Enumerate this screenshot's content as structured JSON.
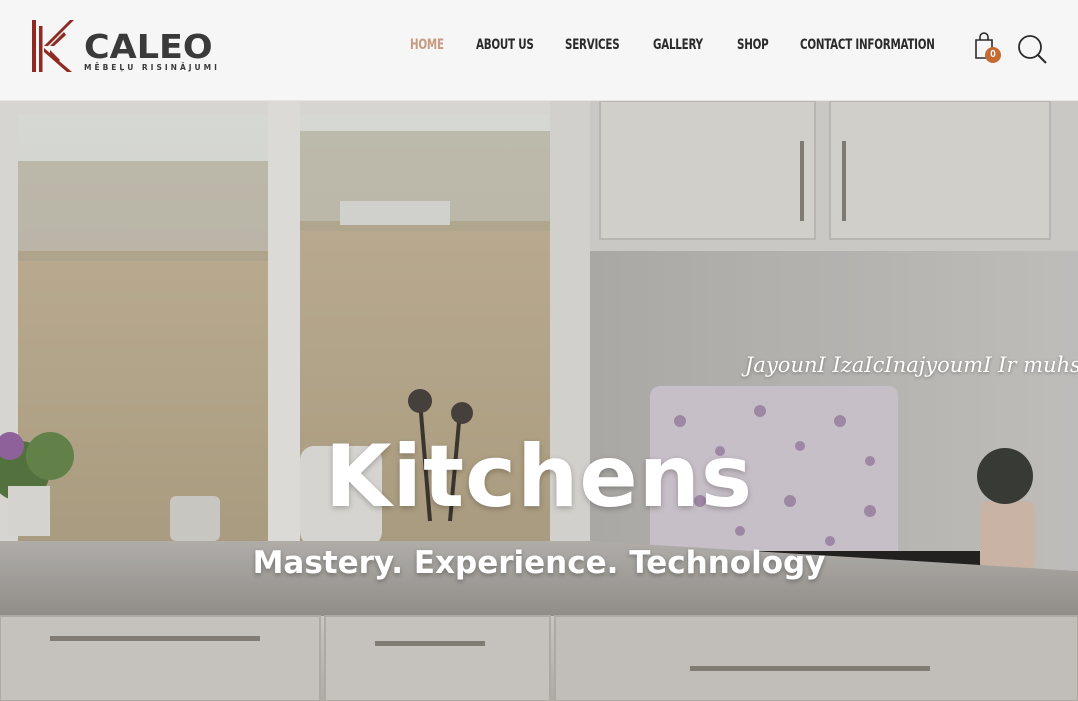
{
  "header": {
    "logo": {
      "name": "CALEO",
      "tagline": "MĒBEĻU RISINĀJUMI",
      "mark_color": "#8f2a22"
    },
    "nav": [
      {
        "label": "HOME",
        "active": true
      },
      {
        "label": "ABOUT US",
        "active": false
      },
      {
        "label": "SERVICES",
        "active": false
      },
      {
        "label": "GALLERY",
        "active": false
      },
      {
        "label": "SHOP",
        "active": false
      },
      {
        "label": "CONTACT INFORMATION",
        "active": false
      }
    ],
    "cart": {
      "icon": "shopping-bag-icon",
      "count": "0"
    },
    "search": {
      "icon": "search-icon"
    },
    "colors": {
      "active_nav": "#c79a82",
      "badge": "#c56b32",
      "text": "#2b2b2b"
    }
  },
  "hero": {
    "marquee_text": "JayounI IzaIcInajyoumI Ir muhsyc",
    "title": "Kitchens",
    "subtitle": "Mastery. Experience. Technology"
  }
}
